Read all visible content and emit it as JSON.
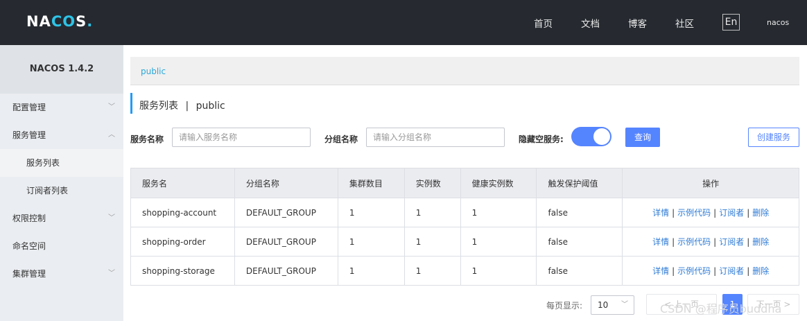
{
  "header": {
    "logo_prefix": "NA",
    "logo_o": "C",
    "logo_mid": "O",
    "logo_end": "S",
    "logo_dot": ".",
    "nav": [
      "首页",
      "文档",
      "博客",
      "社区"
    ],
    "lang": "En",
    "user": "nacos"
  },
  "sidebar": {
    "version": "NACOS 1.4.2",
    "items": [
      {
        "label": "配置管理",
        "chevron": "chevron-down"
      },
      {
        "label": "服务管理",
        "chevron": "chevron-up"
      },
      {
        "label": "服务列表"
      },
      {
        "label": "订阅者列表"
      },
      {
        "label": "权限控制",
        "chevron": "chevron-down"
      },
      {
        "label": "命名空间"
      },
      {
        "label": "集群管理",
        "chevron": "chevron-down"
      }
    ]
  },
  "namespace": {
    "current": "public"
  },
  "page": {
    "title": "服务列表",
    "sep": "|",
    "ns": "public"
  },
  "filters": {
    "service_name_label": "服务名称",
    "service_name_placeholder": "请输入服务名称",
    "group_label": "分组名称",
    "group_placeholder": "请输入分组名称",
    "hide_empty_label": "隐藏空服务:",
    "hide_empty_on": true,
    "query_button": "查询",
    "create_button": "创建服务"
  },
  "table": {
    "columns": [
      "服务名",
      "分组名称",
      "集群数目",
      "实例数",
      "健康实例数",
      "触发保护阈值",
      "操作"
    ],
    "rows": [
      {
        "name": "shopping-account",
        "group": "DEFAULT_GROUP",
        "clusters": "1",
        "instances": "1",
        "healthy": "1",
        "threshold": "false"
      },
      {
        "name": "shopping-order",
        "group": "DEFAULT_GROUP",
        "clusters": "1",
        "instances": "1",
        "healthy": "1",
        "threshold": "false"
      },
      {
        "name": "shopping-storage",
        "group": "DEFAULT_GROUP",
        "clusters": "1",
        "instances": "1",
        "healthy": "1",
        "threshold": "false"
      }
    ],
    "ops": [
      "详情",
      "示例代码",
      "订阅者",
      "删除"
    ],
    "op_sep": "|"
  },
  "pagination": {
    "per_page_label": "每页显示:",
    "per_page_value": "10",
    "prev": "< 上一页",
    "current": "1",
    "next": "下一页 >"
  },
  "watermark": "CSDN @程序员buddha",
  "colors": {
    "primary": "#5584ff",
    "header_bg": "#262a30",
    "link": "#2e7bd6"
  }
}
